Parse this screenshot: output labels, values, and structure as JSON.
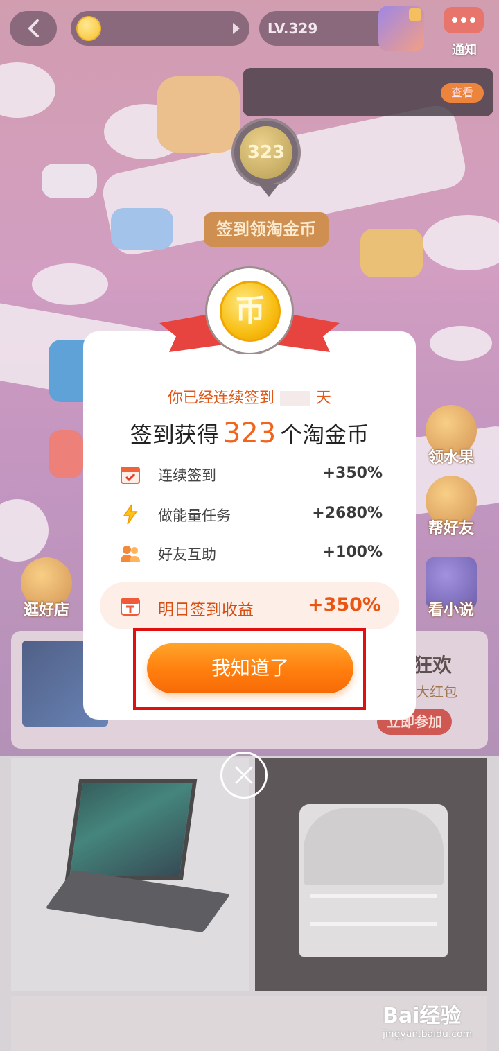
{
  "header": {
    "level_label": "LV.329",
    "notice_label": "通知",
    "notification": {
      "view_label": "查看"
    }
  },
  "map": {
    "pin_coins": "323",
    "sign_in_banner": "签到领淘金币"
  },
  "side_buttons": [
    {
      "label": "领水果"
    },
    {
      "label": "帮好友"
    },
    {
      "label": "看小说"
    },
    {
      "label": "逛好店"
    }
  ],
  "promo": {
    "title": "狂欢",
    "subtitle": "大红包",
    "join_label": "立即参加"
  },
  "dialog": {
    "coin_glyph": "币",
    "streak_prefix": "你已经连续签到",
    "streak_suffix": "天",
    "earn_prefix": "签到获得",
    "earn_amount": "323",
    "earn_suffix": "个淘金币",
    "bonuses": [
      {
        "icon": "calendar-check-icon",
        "name": "连续签到",
        "value": "+350%"
      },
      {
        "icon": "lightning-icon",
        "name": "做能量任务",
        "value": "+2680%"
      },
      {
        "icon": "friends-icon",
        "name": "好友互助",
        "value": "+100%"
      }
    ],
    "tomorrow": {
      "icon": "calendar-t-icon",
      "name": "明日签到收益",
      "value": "+350%"
    },
    "ok_label": "我知道了"
  },
  "watermark": {
    "logo": "Bai经验",
    "url": "jingyan.baidu.com"
  },
  "colors": {
    "accent_orange": "#ff7e0e",
    "ribbon_red": "#e8443f",
    "coin_gold": "#f8be12",
    "highlight_box": "#e01010"
  }
}
